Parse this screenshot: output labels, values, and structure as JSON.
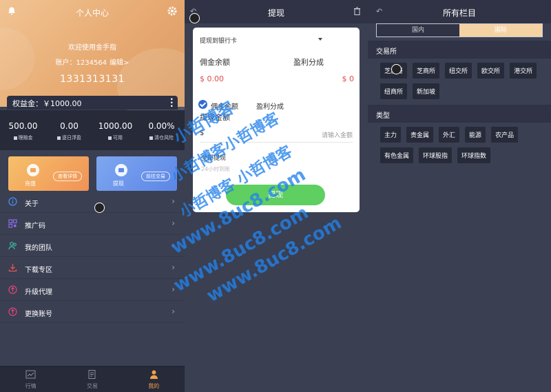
{
  "profile": {
    "title": "个人中心",
    "welcome": "欢迎使用金手指",
    "account_label": "账户：1234564",
    "edit_label": "编辑>",
    "phone": "1331313131",
    "equity": "权益金：￥1000.00",
    "stats": [
      {
        "value": "500.00",
        "label": "理赔金"
      },
      {
        "value": "0.00",
        "label": "逐日浮盈"
      },
      {
        "value": "1000.00",
        "label": "可用"
      },
      {
        "value": "0.00%",
        "label": "清仓风险"
      }
    ],
    "cards": [
      {
        "title": "充值",
        "pill": "查看详情"
      },
      {
        "title": "提现",
        "pill": "前往交易"
      }
    ],
    "menu": [
      {
        "label": "关于",
        "icon": "info-icon"
      },
      {
        "label": "推广码",
        "icon": "qrcode-icon"
      },
      {
        "label": "我的团队",
        "icon": "team-icon"
      },
      {
        "label": "下载专区",
        "icon": "download-icon"
      },
      {
        "label": "升级代理",
        "icon": "upgrade-icon"
      },
      {
        "label": "更换账号",
        "icon": "switch-icon"
      }
    ],
    "tabs": [
      {
        "label": "行情",
        "icon": "chart-icon"
      },
      {
        "label": "交易",
        "icon": "document-icon"
      },
      {
        "label": "我的",
        "icon": "user-icon"
      }
    ]
  },
  "withdraw": {
    "title": "提现",
    "method": "提现到银行卡",
    "commission_label": "佣金余额",
    "profit_label": "盈利分成",
    "commission_value": "$ 0.00",
    "profit_value": "$ 0",
    "option_commission": "佣金余额",
    "option_profit": "盈利分成",
    "amount_label": "提现金额",
    "currency": "$",
    "amount_placeholder": "请输入金额",
    "withdraw_all": "全部提现",
    "hint": "24小时到账",
    "button": "提现"
  },
  "categories": {
    "title": "所有栏目",
    "segments": [
      "国内",
      "国际"
    ],
    "exchange_header": "交易所",
    "exchanges": [
      "芝加哥",
      "芝商所",
      "纽交所",
      "欧交所",
      "港交所",
      "纽商所",
      "新加坡"
    ],
    "type_header": "类型",
    "types": [
      "主力",
      "贵金属",
      "外汇",
      "能源",
      "农产品",
      "有色金属",
      "环球股指",
      "环球指数"
    ]
  },
  "watermark": {
    "line1": "小哲博客",
    "line2": "小哲博客小哲博客",
    "line3": "小哲博客 小哲博客",
    "line4": "www.8uc8.com",
    "line5": "www.8uc8.com",
    "line6": "www.8uc8.com"
  },
  "colors": {
    "header_gradient": "#e7aa72",
    "dark_bg": "#3a3f52",
    "accent_orange": "#f0a04b",
    "accent_green": "#5fcf62",
    "accent_red": "#e14b4b",
    "watermark_blue": "#2382eb"
  }
}
